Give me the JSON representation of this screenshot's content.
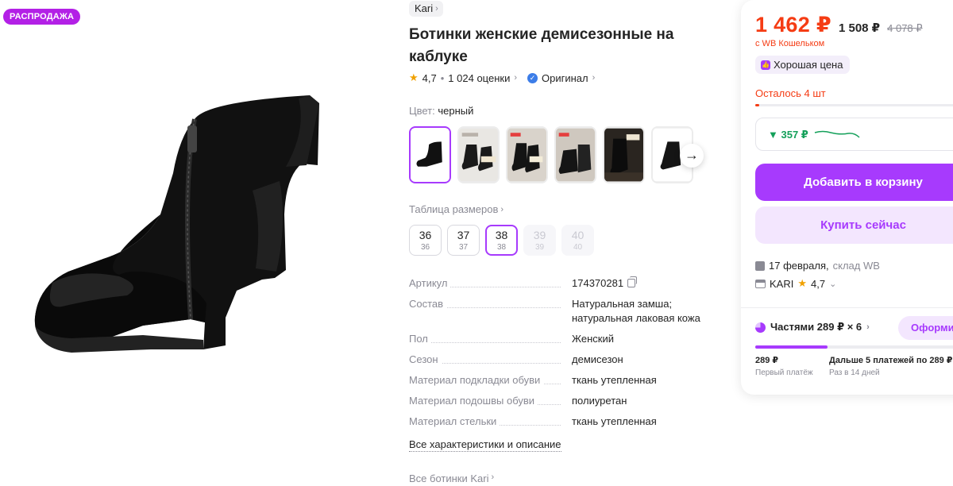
{
  "gallery": {
    "sale_badge": "РАСПРОДАЖА"
  },
  "product": {
    "brand": "Kari",
    "title": "Ботинки женские демисезонные на каблуке",
    "rating": "4,7",
    "reviews": "1 024 оценки",
    "original_label": "Оригинал",
    "color_label": "Цвет:",
    "color_value": "черный",
    "size_table_label": "Таблица размеров",
    "sizes": [
      {
        "size": "36",
        "ru": "36",
        "state": "normal"
      },
      {
        "size": "37",
        "ru": "37",
        "state": "normal"
      },
      {
        "size": "38",
        "ru": "38",
        "state": "selected"
      },
      {
        "size": "39",
        "ru": "39",
        "state": "disabled"
      },
      {
        "size": "40",
        "ru": "40",
        "state": "disabled"
      }
    ],
    "specs": [
      {
        "key": "Артикул",
        "value": "174370281"
      },
      {
        "key": "Состав",
        "value": "Натуральная замша; натуральная лаковая кожа"
      },
      {
        "key": "Пол",
        "value": "Женский"
      },
      {
        "key": "Сезон",
        "value": "демисезон"
      },
      {
        "key": "Материал подкладки обуви",
        "value": "ткань утепленная"
      },
      {
        "key": "Материал подошвы обуви",
        "value": "полиуретан"
      },
      {
        "key": "Материал стельки",
        "value": "ткань утепленная"
      }
    ],
    "all_specs_link": "Все характеристики и описание",
    "all_brand_link": "Все ботинки Kari"
  },
  "buy": {
    "price": "1 462 ₽",
    "price_alt": "1 508 ₽",
    "price_old": "4 078 ₽",
    "wallet_note": "с WB Кошельком",
    "good_price": "Хорошая цена",
    "stock_left": "Осталось 4 шт",
    "price_drop": "▼ 357 ₽",
    "add_to_cart": "Добавить в корзину",
    "buy_now": "Купить сейчас",
    "delivery_date": "17 февраля,",
    "delivery_warehouse": "склад WB",
    "seller_name": "KARI",
    "seller_rating": "4,7",
    "installments": "Частями 289 ₽ × 6",
    "installments_button": "Оформи",
    "first_payment_amount": "289 ₽",
    "first_payment_label": "Первый платёж",
    "next_payments_amount": "Дальше 5 платежей по 289 ₽",
    "next_payments_label": "Раз в 14 дней"
  },
  "colors": {
    "accent": "#a73afd",
    "price_red": "#f53c14",
    "sale_badge": "#b320e6",
    "trend_green": "#14a05a"
  },
  "icons": [
    "chevron-right-icon",
    "star-icon",
    "verified-icon",
    "arrow-right-icon",
    "copy-icon",
    "thumb-up-icon",
    "box-icon",
    "shop-icon",
    "pie-icon"
  ]
}
